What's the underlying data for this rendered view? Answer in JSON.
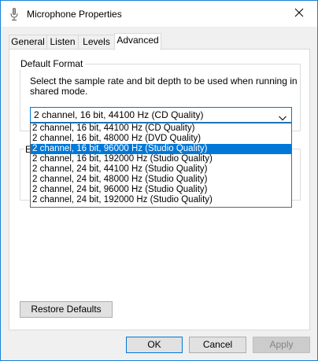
{
  "window": {
    "title": "Microphone Properties",
    "icon": "microphone-icon",
    "close_icon": "close-icon"
  },
  "tabs": [
    {
      "label": "General",
      "active": false
    },
    {
      "label": "Listen",
      "active": false
    },
    {
      "label": "Levels",
      "active": false
    },
    {
      "label": "Advanced",
      "active": true
    }
  ],
  "default_format": {
    "group_title": "Default Format",
    "description": "Select the sample rate and bit depth to be used when running in shared mode.",
    "selected_value": "2 channel, 16 bit, 44100 Hz (CD Quality)",
    "options": [
      {
        "label": "2 channel, 16 bit, 44100 Hz (CD Quality)",
        "highlighted": false
      },
      {
        "label": "2 channel, 16 bit, 48000 Hz (DVD Quality)",
        "highlighted": false
      },
      {
        "label": "2 channel, 16 bit, 96000 Hz (Studio Quality)",
        "highlighted": true
      },
      {
        "label": "2 channel, 16 bit, 192000 Hz (Studio Quality)",
        "highlighted": false
      },
      {
        "label": "2 channel, 24 bit, 44100 Hz (Studio Quality)",
        "highlighted": false
      },
      {
        "label": "2 channel, 24 bit, 48000 Hz (Studio Quality)",
        "highlighted": false
      },
      {
        "label": "2 channel, 24 bit, 96000 Hz (Studio Quality)",
        "highlighted": false
      },
      {
        "label": "2 channel, 24 bit, 192000 Hz (Studio Quality)",
        "highlighted": false
      }
    ]
  },
  "partial_group_label": "E",
  "buttons": {
    "restore_defaults": "Restore Defaults",
    "ok": "OK",
    "cancel": "Cancel",
    "apply": "Apply"
  },
  "colors": {
    "accent": "#0078d7",
    "window_border": "#1883d7"
  }
}
